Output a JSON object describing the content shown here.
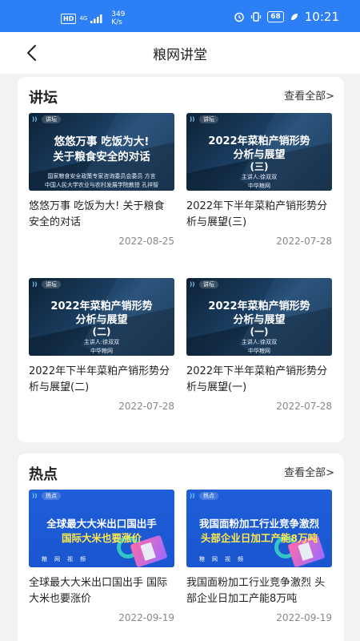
{
  "status_bar": {
    "hd": "HD",
    "network": "4G",
    "speed": "349\nK/s",
    "battery": "68",
    "time": "10:21"
  },
  "header": {
    "title": "粮网讲堂"
  },
  "sections": [
    {
      "title": "讲坛",
      "more": "查看全部>",
      "items": [
        {
          "tag": "讲坛",
          "thumb_title": [
            "悠悠万事 吃饭为大!",
            "关于粮食安全的对话"
          ],
          "thumb_sub": [
            "国家粮食安全政策专家咨询委员会委员 方言",
            "中国人民大学农业与农村发展学院教授 孔祥智"
          ],
          "title": "悠悠万事 吃饭为大! 关于粮食安全的对话",
          "date": "2022-08-25"
        },
        {
          "tag": "讲坛",
          "thumb_title": [
            "2022年菜粕产销形势",
            "分析与展望",
            "(三)"
          ],
          "thumb_sub": [
            "主讲人:徐双双",
            "中华粮网"
          ],
          "title": "2022年下半年菜粕产销形势分析与展望(三)",
          "date": "2022-07-28"
        },
        {
          "tag": "讲坛",
          "thumb_title": [
            "2022年菜粕产销形势",
            "分析与展望",
            "(二)"
          ],
          "thumb_sub": [
            "主讲人:徐双双",
            "中华粮网"
          ],
          "title": "2022年下半年菜粕产销形势分析与展望(二)",
          "date": "2022-07-28"
        },
        {
          "tag": "讲坛",
          "thumb_title": [
            "2022年菜粕产销形势",
            "分析与展望",
            "(一)"
          ],
          "thumb_sub": [
            "主讲人:徐双双",
            "中华粮网"
          ],
          "title": "2022年下半年菜粕产销形势分析与展望(一)",
          "date": "2022-07-28"
        }
      ]
    },
    {
      "title": "热点",
      "more": "查看全部>",
      "items": [
        {
          "tag": "热点",
          "thumb_line1": "全球最大大米出口国出手",
          "thumb_line2": "国际大米也要涨价",
          "thumb_foot": "粮网视频",
          "title": "全球最大大米出口国出手 国际大米也要涨价",
          "date": "2022-09-19"
        },
        {
          "tag": "热点",
          "thumb_line1": "我国面粉加工行业竞争激烈",
          "thumb_line2": "头部企业日加工产能8万吨",
          "thumb_foot": "粮网视频",
          "title": "我国面粉加工行业竞争激烈 头部企业日加工产能8万吨",
          "date": "2022-09-19"
        }
      ]
    }
  ]
}
